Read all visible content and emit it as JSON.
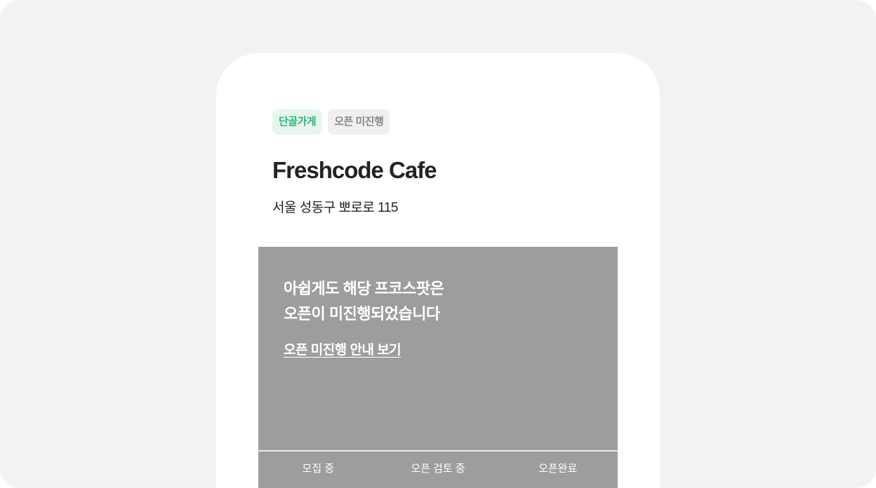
{
  "store": {
    "badges": [
      "단골가게",
      "오픈 미진행"
    ],
    "name": "Freshcode Cafe",
    "address": "서울 성동구 뽀로로 115"
  },
  "notice": {
    "line1": "아쉽게도 해당 프코스팟은",
    "line2": "오픈이 미진행되었습니다",
    "link": "오픈 미진행 안내 보기"
  },
  "progress": {
    "steps": [
      "모집 중",
      "오픈 검토 중",
      "오픈완료"
    ]
  },
  "colors": {
    "accent_green": "#2fb572",
    "panel_gray": "#9d9d9d"
  }
}
